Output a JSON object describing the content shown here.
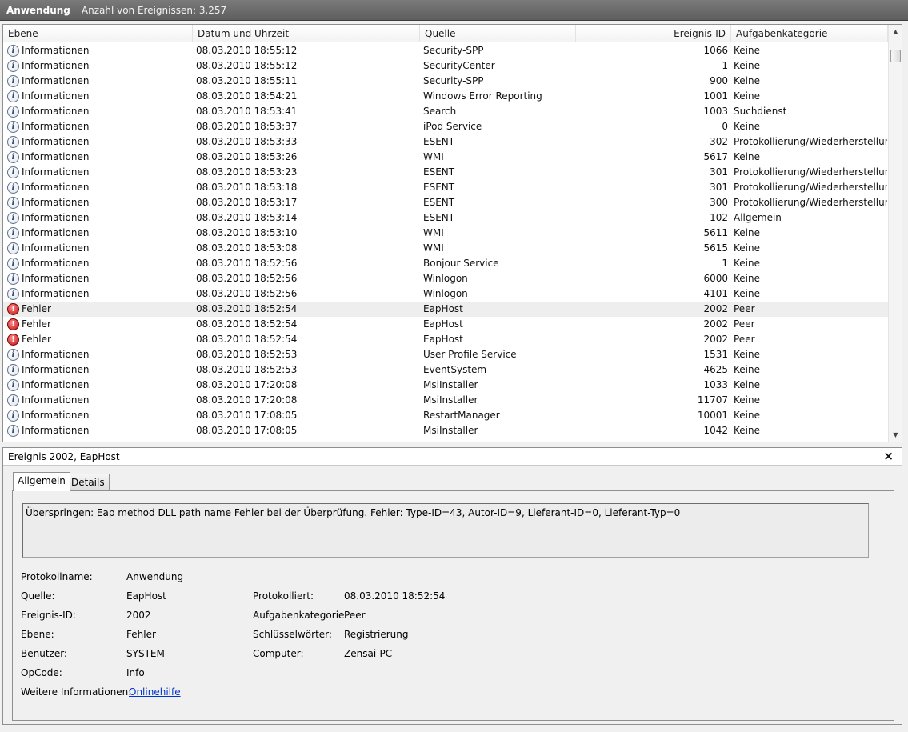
{
  "header": {
    "title": "Anwendung",
    "event_count": "Anzahl von Ereignissen: 3.257"
  },
  "columns": [
    "Ebene",
    "Datum und Uhrzeit",
    "Quelle",
    "Ereignis-ID",
    "Aufgabenkategorie"
  ],
  "events": [
    {
      "level": "Informationen",
      "type": "info",
      "date": "08.03.2010 18:55:12",
      "source": "Security-SPP",
      "id": "1066",
      "category": "Keine"
    },
    {
      "level": "Informationen",
      "type": "info",
      "date": "08.03.2010 18:55:12",
      "source": "SecurityCenter",
      "id": "1",
      "category": "Keine"
    },
    {
      "level": "Informationen",
      "type": "info",
      "date": "08.03.2010 18:55:11",
      "source": "Security-SPP",
      "id": "900",
      "category": "Keine"
    },
    {
      "level": "Informationen",
      "type": "info",
      "date": "08.03.2010 18:54:21",
      "source": "Windows Error Reporting",
      "id": "1001",
      "category": "Keine"
    },
    {
      "level": "Informationen",
      "type": "info",
      "date": "08.03.2010 18:53:41",
      "source": "Search",
      "id": "1003",
      "category": "Suchdienst"
    },
    {
      "level": "Informationen",
      "type": "info",
      "date": "08.03.2010 18:53:37",
      "source": "iPod Service",
      "id": "0",
      "category": "Keine"
    },
    {
      "level": "Informationen",
      "type": "info",
      "date": "08.03.2010 18:53:33",
      "source": "ESENT",
      "id": "302",
      "category": "Protokollierung/Wiederherstellung"
    },
    {
      "level": "Informationen",
      "type": "info",
      "date": "08.03.2010 18:53:26",
      "source": "WMI",
      "id": "5617",
      "category": "Keine"
    },
    {
      "level": "Informationen",
      "type": "info",
      "date": "08.03.2010 18:53:23",
      "source": "ESENT",
      "id": "301",
      "category": "Protokollierung/Wiederherstellung"
    },
    {
      "level": "Informationen",
      "type": "info",
      "date": "08.03.2010 18:53:18",
      "source": "ESENT",
      "id": "301",
      "category": "Protokollierung/Wiederherstellung"
    },
    {
      "level": "Informationen",
      "type": "info",
      "date": "08.03.2010 18:53:17",
      "source": "ESENT",
      "id": "300",
      "category": "Protokollierung/Wiederherstellung"
    },
    {
      "level": "Informationen",
      "type": "info",
      "date": "08.03.2010 18:53:14",
      "source": "ESENT",
      "id": "102",
      "category": "Allgemein"
    },
    {
      "level": "Informationen",
      "type": "info",
      "date": "08.03.2010 18:53:10",
      "source": "WMI",
      "id": "5611",
      "category": "Keine"
    },
    {
      "level": "Informationen",
      "type": "info",
      "date": "08.03.2010 18:53:08",
      "source": "WMI",
      "id": "5615",
      "category": "Keine"
    },
    {
      "level": "Informationen",
      "type": "info",
      "date": "08.03.2010 18:52:56",
      "source": "Bonjour Service",
      "id": "1",
      "category": "Keine"
    },
    {
      "level": "Informationen",
      "type": "info",
      "date": "08.03.2010 18:52:56",
      "source": "Winlogon",
      "id": "6000",
      "category": "Keine"
    },
    {
      "level": "Informationen",
      "type": "info",
      "date": "08.03.2010 18:52:56",
      "source": "Winlogon",
      "id": "4101",
      "category": "Keine"
    },
    {
      "level": "Fehler",
      "type": "error",
      "date": "08.03.2010 18:52:54",
      "source": "EapHost",
      "id": "2002",
      "category": "Peer",
      "selected": true
    },
    {
      "level": "Fehler",
      "type": "error",
      "date": "08.03.2010 18:52:54",
      "source": "EapHost",
      "id": "2002",
      "category": "Peer"
    },
    {
      "level": "Fehler",
      "type": "error",
      "date": "08.03.2010 18:52:54",
      "source": "EapHost",
      "id": "2002",
      "category": "Peer"
    },
    {
      "level": "Informationen",
      "type": "info",
      "date": "08.03.2010 18:52:53",
      "source": "User Profile Service",
      "id": "1531",
      "category": "Keine"
    },
    {
      "level": "Informationen",
      "type": "info",
      "date": "08.03.2010 18:52:53",
      "source": "EventSystem",
      "id": "4625",
      "category": "Keine"
    },
    {
      "level": "Informationen",
      "type": "info",
      "date": "08.03.2010 17:20:08",
      "source": "MsiInstaller",
      "id": "1033",
      "category": "Keine"
    },
    {
      "level": "Informationen",
      "type": "info",
      "date": "08.03.2010 17:20:08",
      "source": "MsiInstaller",
      "id": "11707",
      "category": "Keine"
    },
    {
      "level": "Informationen",
      "type": "info",
      "date": "08.03.2010 17:08:05",
      "source": "RestartManager",
      "id": "10001",
      "category": "Keine"
    },
    {
      "level": "Informationen",
      "type": "info",
      "date": "08.03.2010 17:08:05",
      "source": "MsiInstaller",
      "id": "1042",
      "category": "Keine"
    }
  ],
  "icons": {
    "info": "info-icon",
    "error": "error-icon",
    "close": "close-icon"
  },
  "colors": {
    "selected_row": "#eeeeee",
    "title_bar": "#6a6a6a",
    "link": "#0033cc"
  },
  "detail": {
    "title": "Ereignis 2002, EapHost",
    "close_glyph": "×",
    "tabs": [
      "Allgemein",
      "Details"
    ],
    "message": "Überspringen: Eap method DLL path name Fehler bei der Überprüfung. Fehler: Type-ID=43, Autor-ID=9, Lieferant-ID=0, Lieferant-Typ=0",
    "labels": {
      "log_name": "Protokollname:",
      "source": "Quelle:",
      "event_id": "Ereignis-ID:",
      "level": "Ebene:",
      "user": "Benutzer:",
      "opcode": "OpCode:",
      "more_info": "Weitere Informationen:",
      "logged": "Protokolliert:",
      "task_category": "Aufgabenkategorie:",
      "keywords": "Schlüsselwörter:",
      "computer": "Computer:"
    },
    "values": {
      "log_name": "Anwendung",
      "source": "EapHost",
      "event_id": "2002",
      "level": "Fehler",
      "user": "SYSTEM",
      "opcode": "Info",
      "more_info_link": "Onlinehilfe",
      "logged": "08.03.2010 18:52:54",
      "task_category": "Peer",
      "keywords": "Registrierung",
      "computer": "Zensai-PC"
    }
  }
}
